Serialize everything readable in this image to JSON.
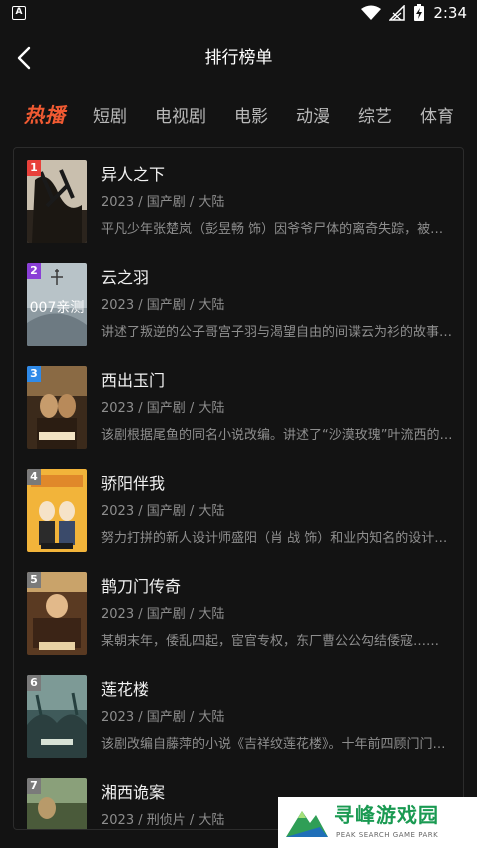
{
  "status_bar": {
    "time": "2:34",
    "app_icon": "A"
  },
  "header": {
    "title": "排行榜单"
  },
  "tabs": [
    {
      "label": "热播",
      "active": true
    },
    {
      "label": "短剧"
    },
    {
      "label": "电视剧"
    },
    {
      "label": "电影"
    },
    {
      "label": "动漫"
    },
    {
      "label": "综艺"
    },
    {
      "label": "体育"
    }
  ],
  "items": [
    {
      "rank": "1",
      "title": "异人之下",
      "meta": "2023 / 国产剧 / 大陆",
      "desc": "平凡少年张楚岚（彭昱畅 饰）因爷爷尸体的离奇失踪，被卷入异人的世界……",
      "badge_color": "#e8403a",
      "poster_caption": ""
    },
    {
      "rank": "2",
      "title": "云之羽",
      "meta": "2023 / 国产剧 / 大陆",
      "desc": "讲述了叛逆的公子哥宫子羽与渴望自由的间谍云为衫的故事……",
      "badge_color": "#8a3fd6",
      "poster_caption": "007亲测"
    },
    {
      "rank": "3",
      "title": "西出玉门",
      "meta": "2023 / 国产剧 / 大陆",
      "desc": "该剧根据尾鱼的同名小说改编。讲述了“沙漠玫瑰”叶流西的故事……",
      "badge_color": "#2f8ae8",
      "poster_caption": ""
    },
    {
      "rank": "4",
      "title": "骄阳伴我",
      "meta": "2023 / 国产剧 / 大陆",
      "desc": "努力打拼的新人设计师盛阳（肖 战 饰）和业内知名的设计师……",
      "badge_color": "#7a7a7a",
      "poster_caption": ""
    },
    {
      "rank": "5",
      "title": "鹊刀门传奇",
      "meta": "2023 / 国产剧 / 大陆",
      "desc": "某朝末年，倭乱四起，宦官专权，东厂曹公公勾结倭寇……",
      "badge_color": "#7a7a7a",
      "poster_caption": ""
    },
    {
      "rank": "6",
      "title": "莲花楼",
      "meta": "2023 / 国产剧 / 大陆",
      "desc": "该剧改编自藤萍的小说《吉祥纹莲花楼》。十年前四顾门门主李相夷……",
      "badge_color": "#7a7a7a",
      "poster_caption": ""
    },
    {
      "rank": "7",
      "title": "湘西诡案",
      "meta": "2023 / 刑侦片 / 大陆",
      "desc": "",
      "badge_color": "#7a7a7a",
      "poster_caption": ""
    }
  ],
  "watermark": {
    "title": "寻峰游戏园",
    "subtitle": "PEAK SEARCH GAME PARK"
  }
}
